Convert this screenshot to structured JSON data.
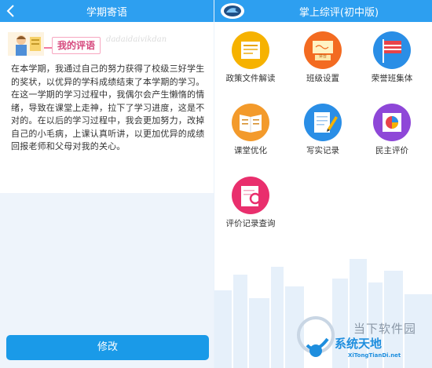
{
  "left_panel": {
    "header": {
      "title": "学期寄语",
      "back_icon": "chevron-left-icon"
    },
    "comment": {
      "tag_label": "我的评语",
      "faint_text": "dadaidaivikdan",
      "body": "在本学期，我通过自己的努力获得了校级三好学生的奖状，以优异的学科成绩结束了本学期的学习。在这一学期的学习过程中，我偶尔会产生懒惰的情绪，导致在课堂上走神，拉下了学习进度，这是不对的。在以后的学习过程中，我会更加努力，改掉自己的小毛病，上课认真听讲，以更加优异的成绩回报老师和父母对我的关心。"
    },
    "edit_button": "修改"
  },
  "right_panel": {
    "header": {
      "title": "掌上综评(初中版)",
      "logo_icon": "app-logo-icon"
    },
    "menu": [
      {
        "label": "政策文件解读",
        "icon": "document-icon",
        "color": "#f6b200"
      },
      {
        "label": "班级设置",
        "icon": "class-settings-icon",
        "color": "#f36b21",
        "badge_text": "讲台"
      },
      {
        "label": "荣誉班集体",
        "icon": "flag-icon",
        "color": "#2a8ee6"
      },
      {
        "label": "课堂优化",
        "icon": "book-icon",
        "color": "#f39a2b"
      },
      {
        "label": "写实记录",
        "icon": "notebook-pencil-icon",
        "color": "#2a8ee6"
      },
      {
        "label": "民主评价",
        "icon": "pie-chart-icon",
        "color": "#8e47d8"
      },
      {
        "label": "评价记录查询",
        "icon": "search-record-icon",
        "color": "#e92f6d"
      }
    ]
  },
  "watermark": {
    "top_text": "当下软件园",
    "brand": "系统天地",
    "url": "XiTongTianDi.net"
  },
  "colors": {
    "header_blue": "#2d9ff0",
    "button_blue": "#1a9ae8",
    "tag_pink": "#d64a7e"
  }
}
